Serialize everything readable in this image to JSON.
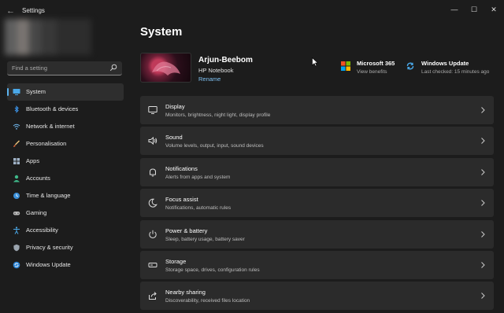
{
  "window": {
    "title": "Settings",
    "back_glyph": "←",
    "minimize": "—",
    "maximize": "☐",
    "close": "✕"
  },
  "search": {
    "placeholder": "Find a setting"
  },
  "sidebar": {
    "items": [
      {
        "label": "System",
        "icon": "monitor-icon",
        "active": true
      },
      {
        "label": "Bluetooth & devices",
        "icon": "bluetooth-icon"
      },
      {
        "label": "Network & internet",
        "icon": "wifi-icon"
      },
      {
        "label": "Personalisation",
        "icon": "brush-icon"
      },
      {
        "label": "Apps",
        "icon": "apps-icon"
      },
      {
        "label": "Accounts",
        "icon": "person-icon"
      },
      {
        "label": "Time & language",
        "icon": "globe-clock-icon"
      },
      {
        "label": "Gaming",
        "icon": "gamepad-icon"
      },
      {
        "label": "Accessibility",
        "icon": "accessibility-icon"
      },
      {
        "label": "Privacy & security",
        "icon": "shield-icon"
      },
      {
        "label": "Windows Update",
        "icon": "update-icon"
      }
    ]
  },
  "main": {
    "title": "System",
    "device": {
      "name": "Arjun-Beebom",
      "model": "HP Notebook",
      "rename": "Rename"
    },
    "top_cards": [
      {
        "title": "Microsoft 365",
        "subtitle": "View benefits",
        "icon": "microsoft-logo-icon"
      },
      {
        "title": "Windows Update",
        "subtitle": "Last checked: 15 minutes ago",
        "icon": "update-icon"
      }
    ],
    "settings": [
      {
        "title": "Display",
        "desc": "Monitors, brightness, night light, display profile",
        "icon": "display-icon"
      },
      {
        "title": "Sound",
        "desc": "Volume levels, output, input, sound devices",
        "icon": "speaker-icon"
      },
      {
        "title": "Notifications",
        "desc": "Alerts from apps and system",
        "icon": "bell-icon"
      },
      {
        "title": "Focus assist",
        "desc": "Notifications, automatic rules",
        "icon": "moon-icon"
      },
      {
        "title": "Power & battery",
        "desc": "Sleep, battery usage, battery saver",
        "icon": "power-icon"
      },
      {
        "title": "Storage",
        "desc": "Storage space, drives, configuration rules",
        "icon": "storage-icon"
      },
      {
        "title": "Nearby sharing",
        "desc": "Discoverability, received files location",
        "icon": "share-icon"
      }
    ]
  },
  "colors": {
    "accent": "#5cb4f0",
    "background": "#1c1c1c",
    "card": "#2b2b2b"
  }
}
